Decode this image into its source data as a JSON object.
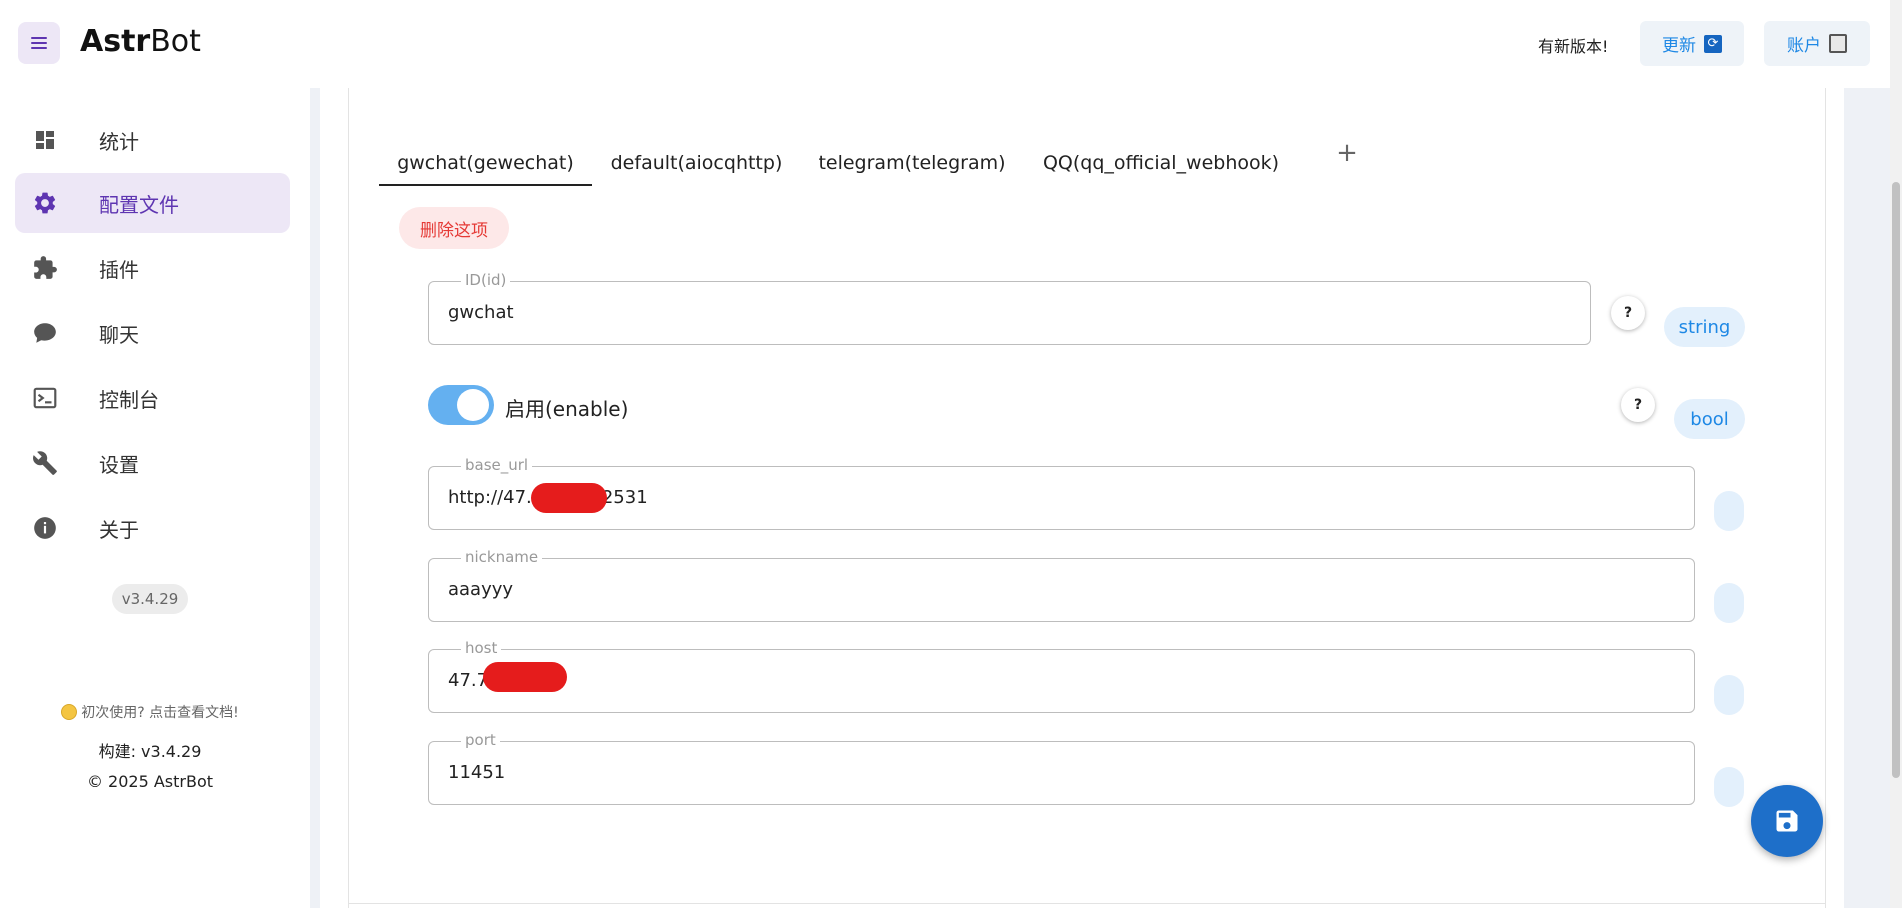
{
  "header": {
    "brand_bold": "Astr",
    "brand_rest": "Bot",
    "new_version_text": "有新版本!",
    "update_label": "更新",
    "account_label": "账户"
  },
  "sidebar": {
    "items": [
      {
        "label": "统计",
        "icon": "dashboard-icon"
      },
      {
        "label": "配置文件",
        "icon": "gear-icon",
        "active": true
      },
      {
        "label": "插件",
        "icon": "puzzle-icon"
      },
      {
        "label": "聊天",
        "icon": "chat-bubble-icon"
      },
      {
        "label": "控制台",
        "icon": "console-icon"
      },
      {
        "label": "设置",
        "icon": "wrench-icon"
      },
      {
        "label": "关于",
        "icon": "info-icon"
      }
    ],
    "version": "v3.4.29",
    "doc_link": "初次使用? 点击查看文档!",
    "build": "构建: v3.4.29",
    "copyright": "© 2025 AstrBot"
  },
  "tabs": [
    {
      "label": "gwchat(gewechat)",
      "active": true
    },
    {
      "label": "default(aiocqhttp)"
    },
    {
      "label": "telegram(telegram)"
    },
    {
      "label": "QQ(qq_official_webhook)"
    }
  ],
  "delete_label": "删除这项",
  "fields": {
    "id": {
      "legend": "ID(id)",
      "value": "gwchat",
      "type": "string"
    },
    "enable": {
      "label": "启用(enable)",
      "value": true,
      "type": "bool"
    },
    "base_url": {
      "legend": "base_url",
      "value_prefix": "http://47.",
      "value_suffix": ":2531"
    },
    "nickname": {
      "legend": "nickname",
      "value": "aaayyy"
    },
    "host": {
      "legend": "host",
      "value_prefix": "47.7"
    },
    "port": {
      "legend": "port",
      "value": "11451"
    }
  },
  "help_symbol": "?",
  "colors": {
    "accent": "#5e35b1",
    "primary": "#1e88e5",
    "danger": "#e53935",
    "toggle_on": "#64b0f0"
  }
}
